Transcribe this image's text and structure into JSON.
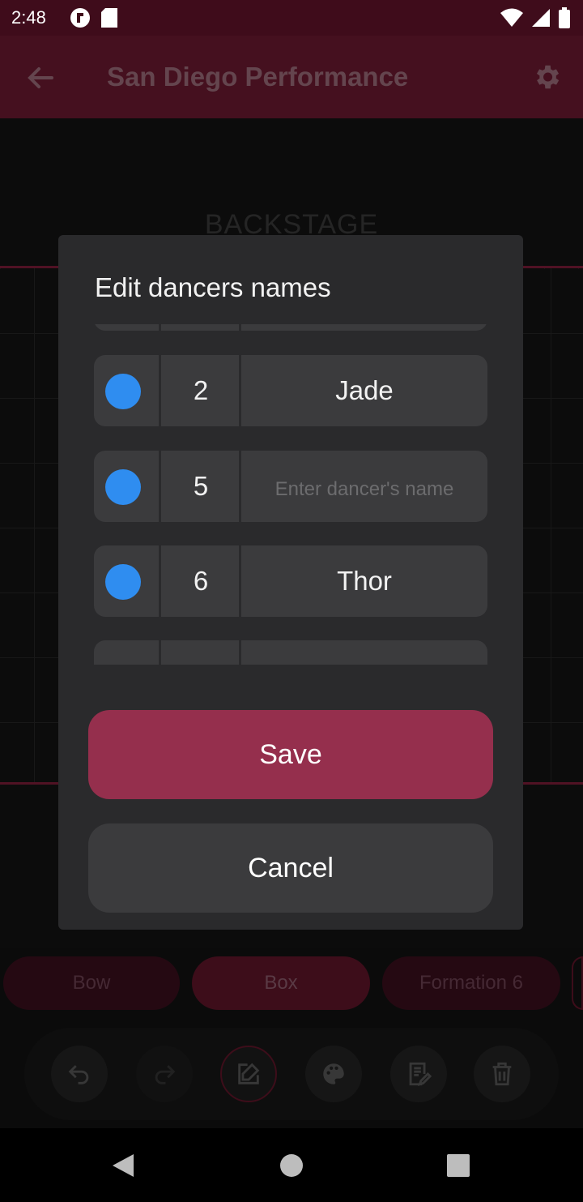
{
  "status_bar": {
    "time": "2:48"
  },
  "app_bar": {
    "title": "San Diego Performance"
  },
  "stage": {
    "backstage_label": "BACKSTAGE"
  },
  "dialog": {
    "title": "Edit dancers names",
    "dancers": [
      {
        "number": "2",
        "name": "Jade",
        "color": "#2f8df0"
      },
      {
        "number": "5",
        "name": "",
        "color": "#2f8df0"
      },
      {
        "number": "6",
        "name": "Thor",
        "color": "#2f8df0"
      }
    ],
    "name_placeholder": "Enter dancer's name",
    "save_label": "Save",
    "cancel_label": "Cancel"
  },
  "formations": [
    {
      "label": "Bow",
      "active": false
    },
    {
      "label": "Box",
      "active": true
    },
    {
      "label": "Formation 6",
      "active": false
    }
  ],
  "toolbar": {
    "tools": [
      "undo-icon",
      "redo-icon",
      "edit-icon",
      "palette-icon",
      "notes-icon",
      "delete-icon"
    ]
  },
  "colors": {
    "accent": "#952f4d",
    "app_bar": "#6a1a30",
    "status_bar": "#3f0c1b",
    "dancer_dot": "#2f8df0"
  }
}
